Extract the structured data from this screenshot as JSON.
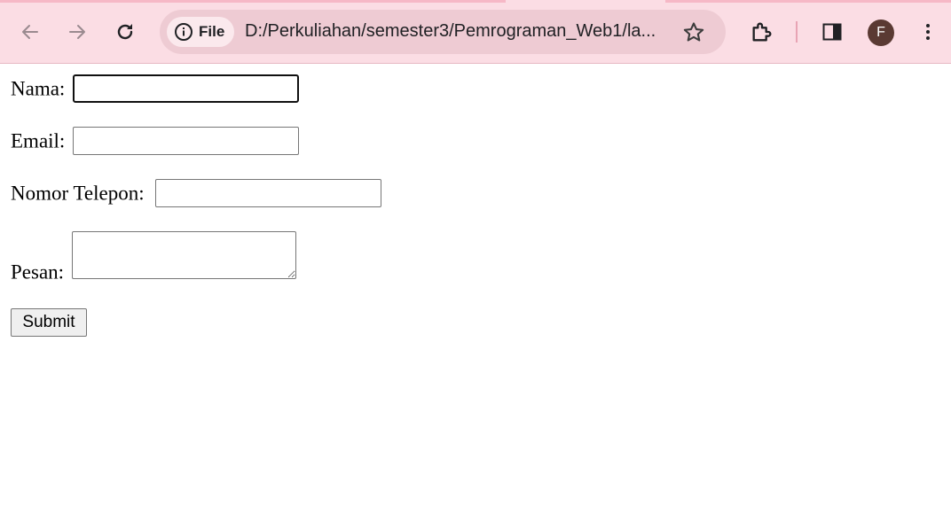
{
  "browser": {
    "page_info_chip": "File",
    "url": "D:/Perkuliahan/semester3/Pemrograman_Web1/la...",
    "profile_initial": "F",
    "icons": [
      "back-arrow-icon",
      "forward-arrow-icon",
      "reload-icon",
      "info-icon",
      "star-icon",
      "extensions-icon",
      "side-panel-icon",
      "more-vert-icon"
    ],
    "accent": "#fbdde4"
  },
  "form": {
    "nama_label": "Nama:",
    "email_label": "Email:",
    "telepon_label": "Nomor Telepon:",
    "pesan_label": "Pesan:",
    "nama_value": "",
    "email_value": "",
    "telepon_value": "",
    "pesan_value": "",
    "submit_label": "Submit"
  }
}
